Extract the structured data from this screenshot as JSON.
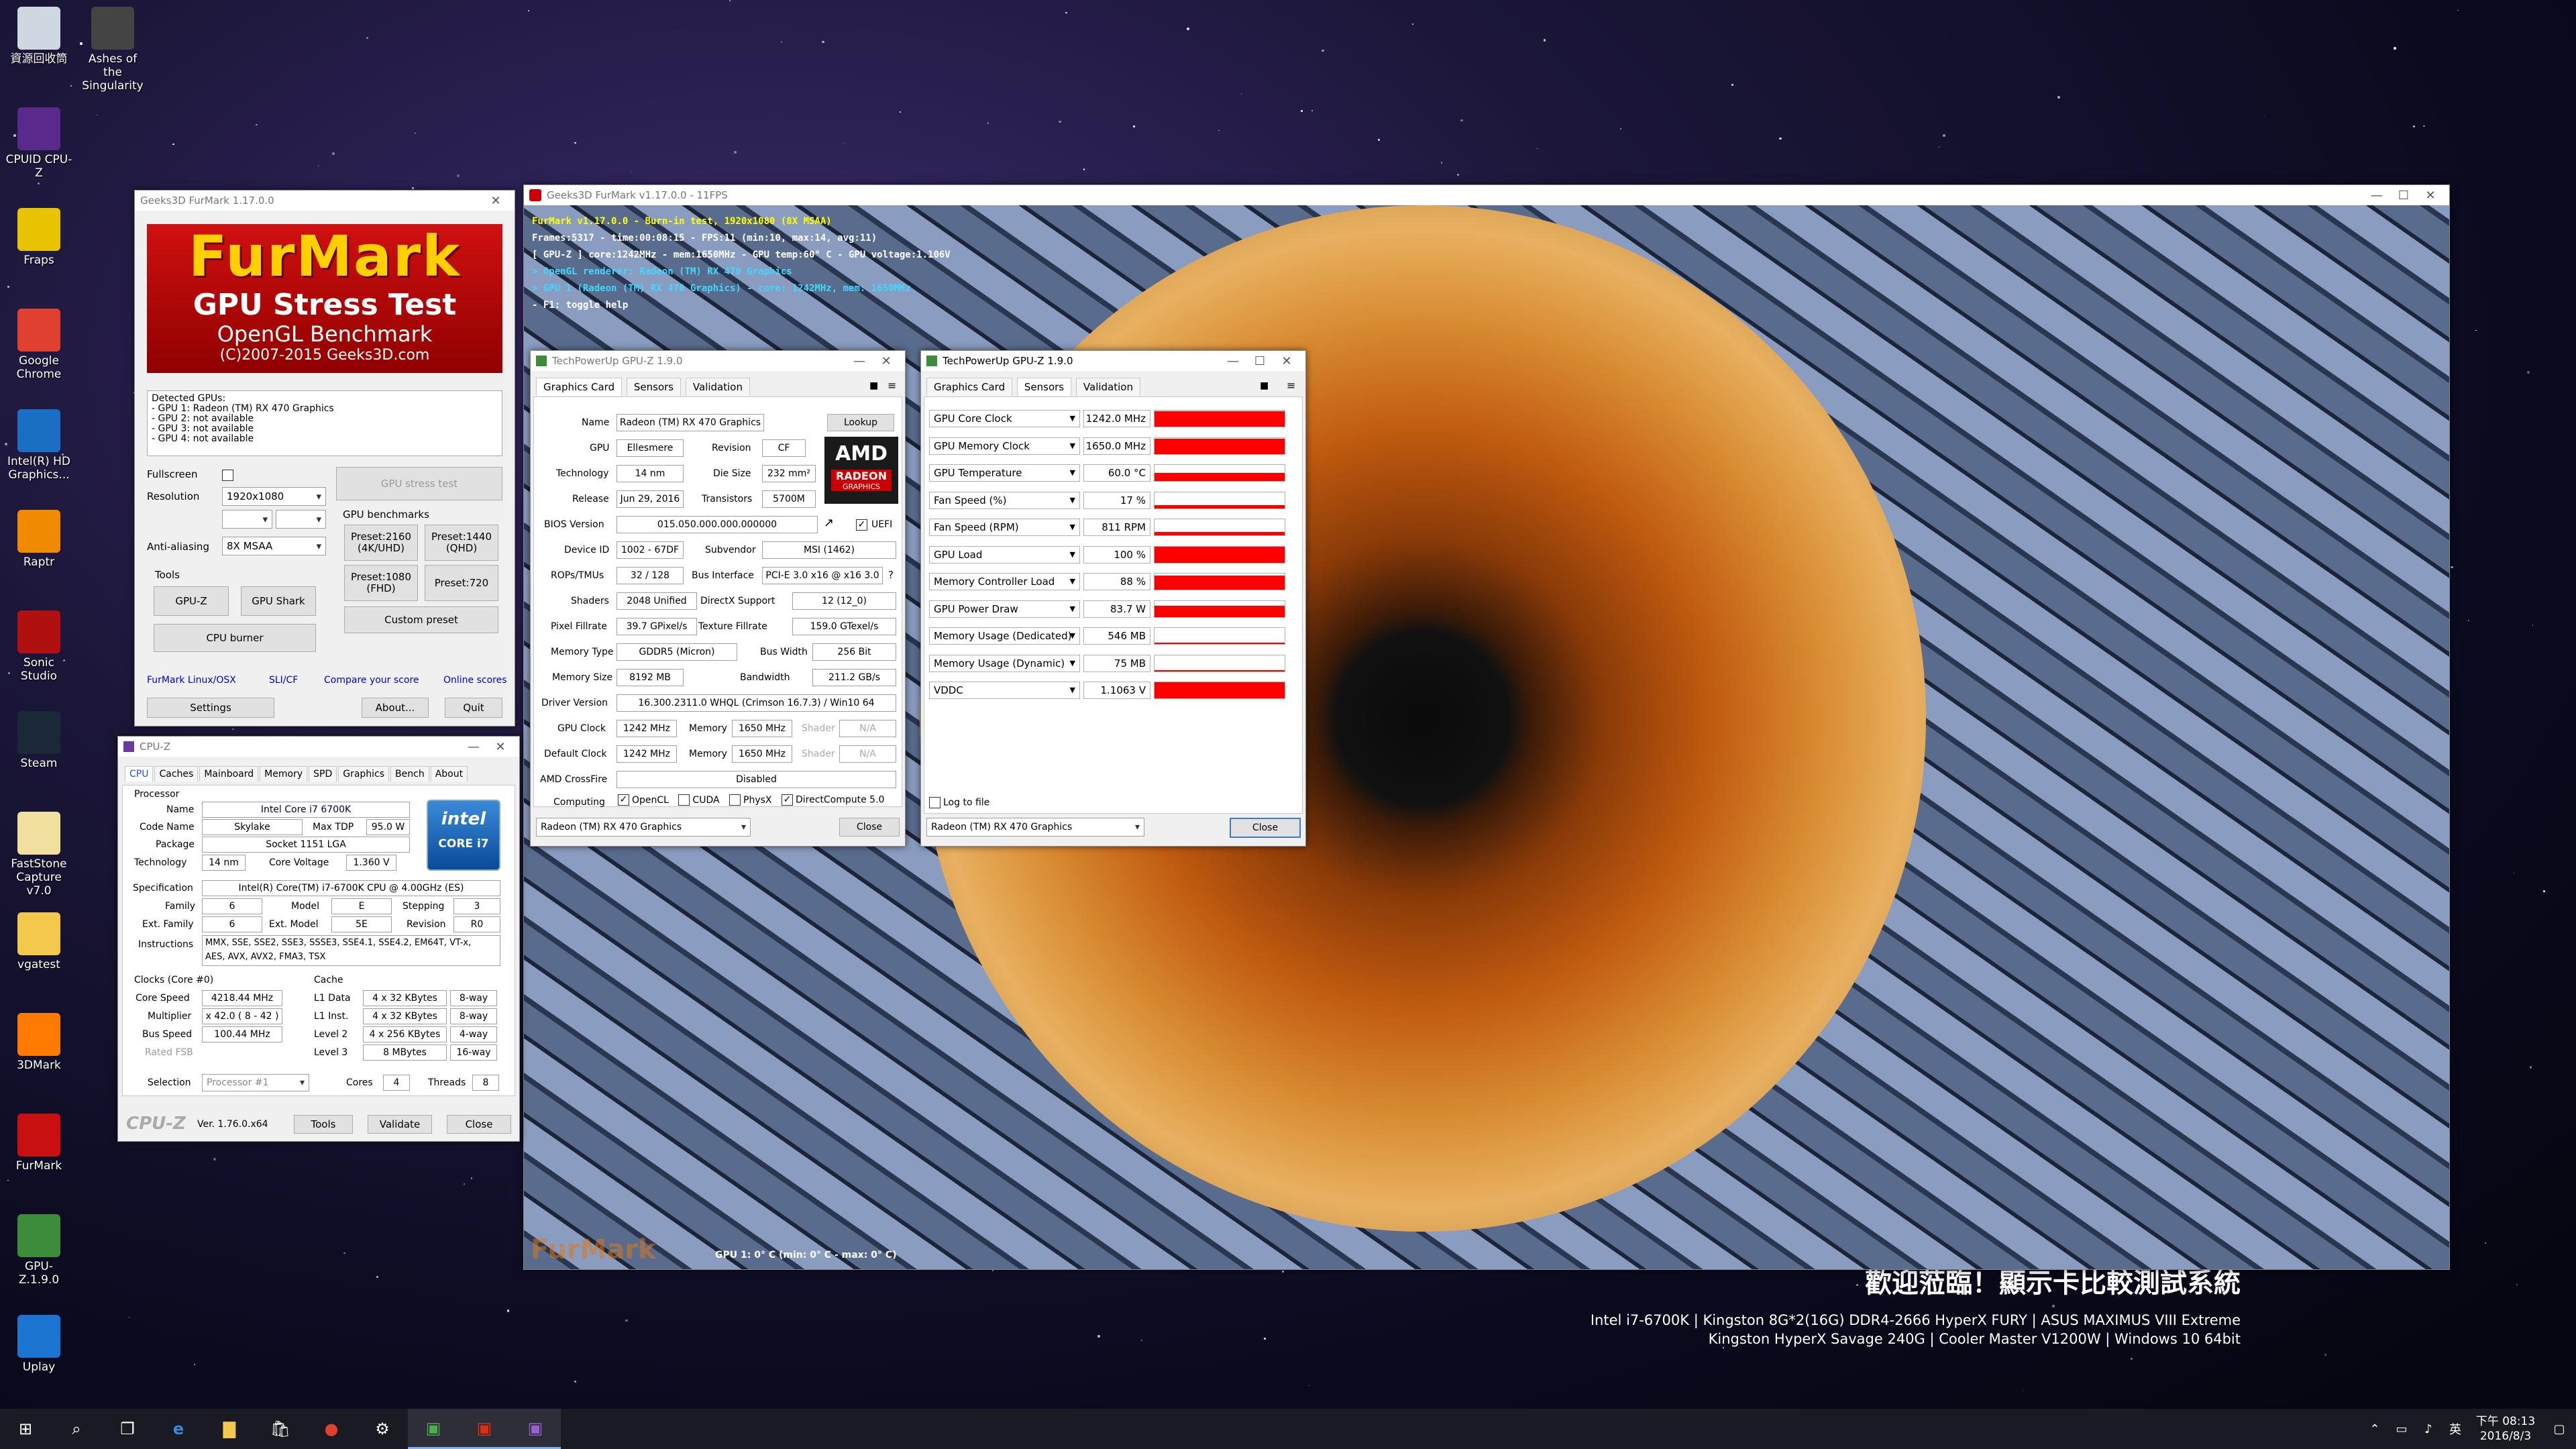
{
  "desktop": {
    "icons": [
      {
        "label": "資源回收筒",
        "icon": "recycle-bin-icon",
        "color": "#cfd8e0"
      },
      {
        "label": "Ashes of the Singularity",
        "icon": "ashes-icon",
        "color": "#444444"
      },
      {
        "label": "CPUID CPU-Z",
        "icon": "cpuz-icon",
        "color": "#5a2a8a"
      },
      {
        "label": "Fraps",
        "icon": "fraps-icon",
        "color": "#e8c400"
      },
      {
        "label": "Google Chrome",
        "icon": "chrome-icon",
        "color": "#e04030"
      },
      {
        "label": "Intel(R) HD Graphics...",
        "icon": "intel-hd-icon",
        "color": "#1a6fc4"
      },
      {
        "label": "Raptr",
        "icon": "raptr-icon",
        "color": "#f08a00"
      },
      {
        "label": "Sonic Studio",
        "icon": "sonic-studio-icon",
        "color": "#b01010"
      },
      {
        "label": "Steam",
        "icon": "steam-icon",
        "color": "#1b2838"
      },
      {
        "label": "FastStone Capture v7.0",
        "icon": "faststone-icon",
        "color": "#f0e0a0"
      },
      {
        "label": "vgatest",
        "icon": "folder-icon",
        "color": "#f2c94c"
      },
      {
        "label": "3DMark",
        "icon": "3dmark-icon",
        "color": "#ff7a00"
      },
      {
        "label": "FurMark",
        "icon": "furmark-icon",
        "color": "#c81010"
      },
      {
        "label": "GPU-Z.1.9.0",
        "icon": "gpuz-icon",
        "color": "#3c8c3c"
      },
      {
        "label": "Uplay",
        "icon": "uplay-icon",
        "color": "#1a74d0"
      }
    ],
    "banner": {
      "title": "歡迎蒞臨！顯示卡比較測試系統",
      "line1": "Intel i7-6700K | Kingston 8G*2(16G) DDR4-2666 HyperX FURY | ASUS MAXIMUS VIII Extreme",
      "line2": "Kingston HyperX Savage 240G | Cooler Master V1200W | Windows 10 64bit"
    }
  },
  "furmark_main": {
    "title": "Geeks3D FurMark 1.17.0.0",
    "logo_title": "FurMark",
    "logo_sub1": "GPU Stress Test",
    "logo_sub2": "OpenGL Benchmark",
    "logo_copy": "(C)2007-2015 Geeks3D.com",
    "detected_header": "Detected GPUs:",
    "gpus": [
      "- GPU 1: Radeon (TM) RX 470 Graphics",
      "- GPU 2: not available",
      "- GPU 3: not available",
      "- GPU 4: not available"
    ],
    "fullscreen_label": "Fullscreen",
    "resolution_label": "Resolution",
    "resolution_value": "1920x1080",
    "aa_label": "Anti-aliasing",
    "aa_value": "8X MSAA",
    "stress_btn": "GPU stress test",
    "benchmarks_label": "GPU benchmarks",
    "preset2160": "Preset:2160\n(4K/UHD)",
    "preset1440": "Preset:1440\n(QHD)",
    "preset1080": "Preset:1080\n(FHD)",
    "preset720": "Preset:720",
    "custom_preset": "Custom preset",
    "tools_label": "Tools",
    "gpuz_btn": "GPU-Z",
    "gpushark_btn": "GPU Shark",
    "cpuburner_btn": "CPU burner",
    "links": [
      "FurMark Linux/OSX",
      "SLI/CF",
      "Compare your score",
      "Online scores"
    ],
    "settings_btn": "Settings",
    "about_btn": "About...",
    "quit_btn": "Quit"
  },
  "furmark_render": {
    "title": "Geeks3D FurMark v1.17.0.0 - 11FPS",
    "overlay": [
      "FurMark v1.17.0.0 - Burn-in test, 1920x1080 (8X MSAA)",
      "Frames:5317 - time:00:08:15 - FPS:11 (min:10, max:14, avg:11)",
      "[ GPU-Z ] core:1242MHz - mem:1650MHz - GPU temp:60° C - GPU voltage:1.106V",
      "> OpenGL renderer: Radeon (TM) RX 470 Graphics",
      "> GPU 1 (Radeon (TM) RX 470 Graphics) - core: 1242MHz, mem: 1650MHz",
      "- F1: toggle help"
    ],
    "graph_label": "GPU 1: 0° C (min: 0° C - max: 0° C)"
  },
  "gpuz_card": {
    "title": "TechPowerUp GPU-Z 1.9.0",
    "tabs": [
      "Graphics Card",
      "Sensors",
      "Validation"
    ],
    "lookup_btn": "Lookup",
    "name_label": "Name",
    "name": "Radeon (TM) RX 470 Graphics",
    "gpu_label": "GPU",
    "gpu": "Ellesmere",
    "revision_label": "Revision",
    "revision": "CF",
    "tech_label": "Technology",
    "tech": "14 nm",
    "die_label": "Die Size",
    "die": "232 mm²",
    "release_label": "Release",
    "release": "Jun 29, 2016",
    "trans_label": "Transistors",
    "trans": "5700M",
    "bios_label": "BIOS Version",
    "bios": "015.050.000.000.000000",
    "uefi_label": "UEFI",
    "devid_label": "Device ID",
    "devid": "1002 - 67DF",
    "subv_label": "Subvendor",
    "subv": "MSI (1462)",
    "rops_label": "ROPs/TMUs",
    "rops": "32 / 128",
    "bus_label": "Bus Interface",
    "bus": "PCI-E 3.0 x16 @ x16 3.0",
    "shaders_label": "Shaders",
    "shaders": "2048 Unified",
    "dx_label": "DirectX Support",
    "dx": "12 (12_0)",
    "pix_label": "Pixel Fillrate",
    "pix": "39.7 GPixel/s",
    "tex_label": "Texture Fillrate",
    "tex": "159.0 GTexel/s",
    "memtype_label": "Memory Type",
    "memtype": "GDDR5 (Micron)",
    "buswidth_label": "Bus Width",
    "buswidth": "256 Bit",
    "memsize_label": "Memory Size",
    "memsize": "8192 MB",
    "bw_label": "Bandwidth",
    "bw": "211.2 GB/s",
    "driver_label": "Driver Version",
    "driver": "16.300.2311.0 WHQL (Crimson 16.7.3) / Win10 64",
    "gpuclock_label": "GPU Clock",
    "gpuclock": "1242 MHz",
    "mem_label": "Memory",
    "memclock": "1650 MHz",
    "shader_label": "Shader",
    "shader": "N/A",
    "defclock_label": "Default Clock",
    "defclock": "1242 MHz",
    "defmem": "1650 MHz",
    "defshader": "N/A",
    "cf_label": "AMD CrossFire",
    "cf": "Disabled",
    "computing_label": "Computing",
    "compute": [
      "OpenCL",
      "CUDA",
      "PhysX",
      "DirectCompute 5.0"
    ],
    "amd_logo": "AMD",
    "radeon_logo": "RADEON",
    "radeon_sub": "GRAPHICS",
    "gpu_select": "Radeon (TM) RX 470 Graphics",
    "close_btn": "Close"
  },
  "gpuz_sensors": {
    "title": "TechPowerUp GPU-Z 1.9.0",
    "tabs": [
      "Graphics Card",
      "Sensors",
      "Validation"
    ],
    "rows": [
      {
        "name": "GPU Core Clock",
        "value": "1242.0 MHz",
        "level": 0.95
      },
      {
        "name": "GPU Memory Clock",
        "value": "1650.0 MHz",
        "level": 0.95
      },
      {
        "name": "GPU Temperature",
        "value": "60.0 °C",
        "level": 0.5
      },
      {
        "name": "Fan Speed (%)",
        "value": "17 %",
        "level": 0.2
      },
      {
        "name": "Fan Speed (RPM)",
        "value": "811 RPM",
        "level": 0.2
      },
      {
        "name": "GPU Load",
        "value": "100 %",
        "level": 1.0
      },
      {
        "name": "Memory Controller Load",
        "value": "88 %",
        "level": 0.88
      },
      {
        "name": "GPU Power Draw",
        "value": "83.7 W",
        "level": 0.7
      },
      {
        "name": "Memory Usage (Dedicated)",
        "value": "546 MB",
        "level": 0.07
      },
      {
        "name": "Memory Usage (Dynamic)",
        "value": "75 MB",
        "level": 0.02
      },
      {
        "name": "VDDC",
        "value": "1.1063 V",
        "level": 1.0
      }
    ],
    "log_label": "Log to file",
    "gpu_select": "Radeon (TM) RX 470 Graphics",
    "close_btn": "Close"
  },
  "cpuz": {
    "title": "CPU-Z",
    "tabs": [
      "CPU",
      "Caches",
      "Mainboard",
      "Memory",
      "SPD",
      "Graphics",
      "Bench",
      "About"
    ],
    "processor_label": "Processor",
    "name_label": "Name",
    "name": "Intel Core i7 6700K",
    "codename_label": "Code Name",
    "codename": "Skylake",
    "maxtdp_label": "Max TDP",
    "maxtdp": "95.0 W",
    "package_label": "Package",
    "package": "Socket 1151 LGA",
    "tech_label": "Technology",
    "tech": "14 nm",
    "voltage_label": "Core Voltage",
    "voltage": "1.360 V",
    "spec_label": "Specification",
    "spec": "Intel(R) Core(TM) i7-6700K CPU @ 4.00GHz (ES)",
    "family_label": "Family",
    "family": "6",
    "model_label": "Model",
    "model": "E",
    "stepping_label": "Stepping",
    "stepping": "3",
    "extfam_label": "Ext. Family",
    "extfam": "6",
    "extmodel_label": "Ext. Model",
    "extmodel": "5E",
    "revision_label": "Revision",
    "revision": "R0",
    "instr_label": "Instructions",
    "instr1": "MMX, SSE, SSE2, SSE3, SSSE3, SSE4.1, SSE4.2, EM64T, VT-x,",
    "instr2": "AES, AVX, AVX2, FMA3, TSX",
    "clocks_label": "Clocks (Core #0)",
    "corespeed_label": "Core Speed",
    "corespeed": "4218.44 MHz",
    "mult_label": "Multiplier",
    "mult": "x 42.0 ( 8 - 42 )",
    "busspeed_label": "Bus Speed",
    "busspeed": "100.44 MHz",
    "ratedfsb_label": "Rated FSB",
    "cache_label": "Cache",
    "l1d_label": "L1 Data",
    "l1d": "4 x 32 KBytes",
    "l1d_way": "8-way",
    "l1i_label": "L1 Inst.",
    "l1i": "4 x 32 KBytes",
    "l1i_way": "8-way",
    "l2_label": "Level 2",
    "l2": "4 x 256 KBytes",
    "l2_way": "4-way",
    "l3_label": "Level 3",
    "l3": "8 MBytes",
    "l3_way": "16-way",
    "selection_label": "Selection",
    "selection": "Processor #1",
    "cores_label": "Cores",
    "cores": "4",
    "threads_label": "Threads",
    "threads": "8",
    "brand": "CPU-Z",
    "version": "Ver. 1.76.0.x64",
    "tools_btn": "Tools",
    "validate_btn": "Validate",
    "close_btn": "Close",
    "intel_logo": "intel",
    "core_i7": "CORE i7"
  },
  "taskbar": {
    "clock_line1": "下午 08:13",
    "clock_line2": "2016/8/3"
  }
}
